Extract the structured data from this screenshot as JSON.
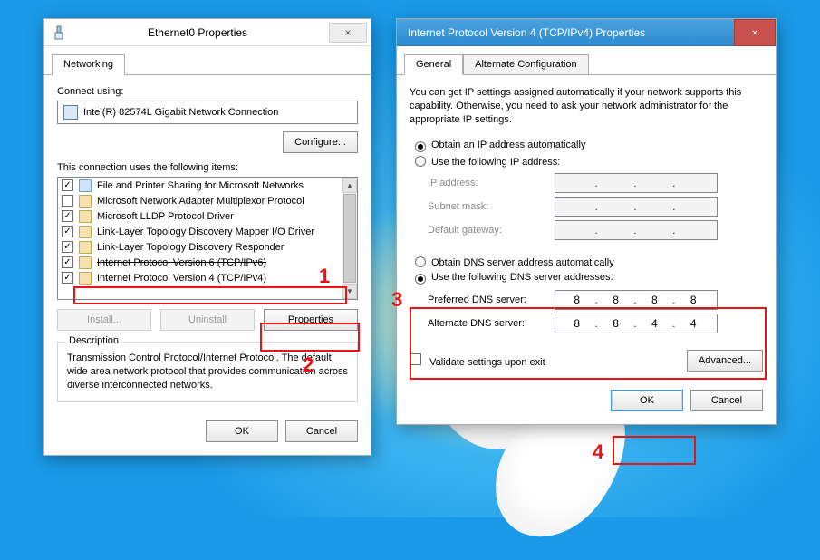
{
  "annotations": {
    "n1": "1",
    "n2": "2",
    "n3": "3",
    "n4": "4"
  },
  "dlg1": {
    "title": "Ethernet0 Properties",
    "close": "×",
    "tab_networking": "Networking",
    "connect_using_label": "Connect using:",
    "adapter": "Intel(R) 82574L Gigabit Network Connection",
    "configure_btn": "Configure...",
    "items_label": "This connection uses the following items:",
    "items": [
      {
        "checked": true,
        "icon": "net",
        "label": "File and Printer Sharing for Microsoft Networks"
      },
      {
        "checked": false,
        "icon": "mini",
        "label": "Microsoft Network Adapter Multiplexor Protocol"
      },
      {
        "checked": true,
        "icon": "mini",
        "label": "Microsoft LLDP Protocol Driver"
      },
      {
        "checked": true,
        "icon": "mini",
        "label": "Link-Layer Topology Discovery Mapper I/O Driver"
      },
      {
        "checked": true,
        "icon": "mini",
        "label": "Link-Layer Topology Discovery Responder"
      },
      {
        "checked": true,
        "icon": "mini",
        "label": "Internet Protocol Version 6 (TCP/IPv6)",
        "strike": true
      },
      {
        "checked": true,
        "icon": "mini",
        "label": "Internet Protocol Version 4 (TCP/IPv4)",
        "selected": true
      }
    ],
    "install_btn": "Install...",
    "uninstall_btn": "Uninstall",
    "properties_btn": "Properties",
    "description_legend": "Description",
    "description_text": "Transmission Control Protocol/Internet Protocol. The default wide area network protocol that provides communication across diverse interconnected networks.",
    "ok": "OK",
    "cancel": "Cancel"
  },
  "dlg2": {
    "title": "Internet Protocol Version 4 (TCP/IPv4) Properties",
    "close": "×",
    "tab_general": "General",
    "tab_alt": "Alternate Configuration",
    "blurb": "You can get IP settings assigned automatically if your network supports this capability. Otherwise, you need to ask your network administrator for the appropriate IP settings.",
    "r_ip_auto": "Obtain an IP address automatically",
    "r_ip_manual": "Use the following IP address:",
    "ip_address_label": "IP address:",
    "subnet_label": "Subnet mask:",
    "gateway_label": "Default gateway:",
    "r_dns_auto": "Obtain DNS server address automatically",
    "r_dns_manual": "Use the following DNS server addresses:",
    "pref_dns_label": "Preferred DNS server:",
    "alt_dns_label": "Alternate DNS server:",
    "pref_dns": [
      "8",
      "8",
      "8",
      "8"
    ],
    "alt_dns": [
      "8",
      "8",
      "4",
      "4"
    ],
    "validate_label": "Validate settings upon exit",
    "advanced_btn": "Advanced...",
    "ok": "OK",
    "cancel": "Cancel"
  }
}
